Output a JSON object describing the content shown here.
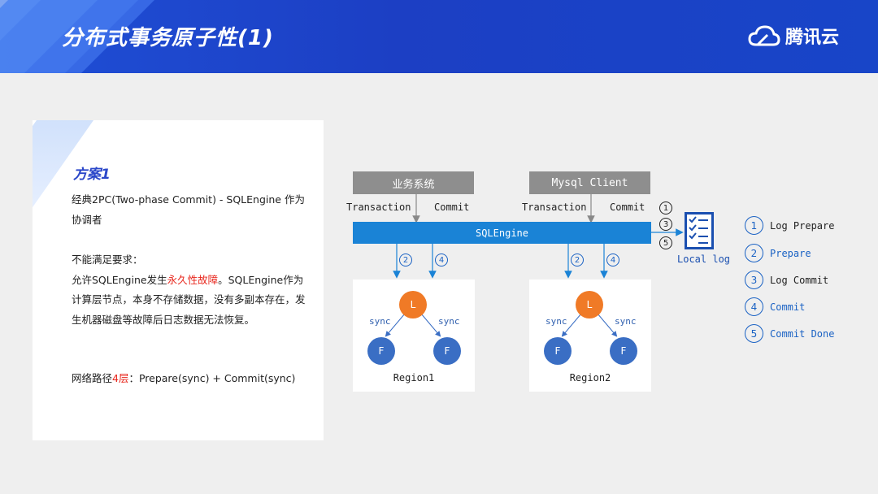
{
  "header": {
    "title": "分布式事务原子性(1)",
    "brand": "腾讯云"
  },
  "left_panel": {
    "plan_title": "方案1",
    "p1": "经典2PC(Two-phase Commit)  - SQLEngine 作为协调者",
    "p2_heading": "不能满足要求：",
    "p2_pre": "允许SQLEngine发生",
    "p2_red": "永久性故障",
    "p2_post": "。SQLEngine作为计算层节点，本身不存储数据，没有多副本存在，发生机器磁盘等故障后日志数据无法恢复。",
    "p3_pre": "网络路径",
    "p3_red": "4层",
    "p3_post": "：Prepare(sync) + Commit(sync)"
  },
  "diagram": {
    "client_left": "业务系统",
    "client_right": "Mysql Client",
    "left_transaction": "Transaction",
    "left_commit": "Commit",
    "right_transaction": "Transaction",
    "right_commit": "Commit",
    "engine": "SQLEngine",
    "local_log": "Local log",
    "step_1": "1",
    "step_2": "2",
    "step_3": "3",
    "step_4": "4",
    "step_5": "5",
    "leader": "L",
    "follower": "F",
    "sync": "sync",
    "region1": "Region1",
    "region2": "Region2"
  },
  "legend": [
    {
      "num": "1",
      "text": "Log Prepare"
    },
    {
      "num": "2",
      "text": "Prepare"
    },
    {
      "num": "3",
      "text": "Log Commit"
    },
    {
      "num": "4",
      "text": "Commit"
    },
    {
      "num": "5",
      "text": "Commit Done"
    }
  ],
  "colors": {
    "header": "#1c3fc4",
    "engine": "#1a83d6",
    "leader": "#f07a26",
    "follower": "#3a6ec4",
    "emphasis": "#e8261c",
    "legend": "#1a62c4"
  }
}
